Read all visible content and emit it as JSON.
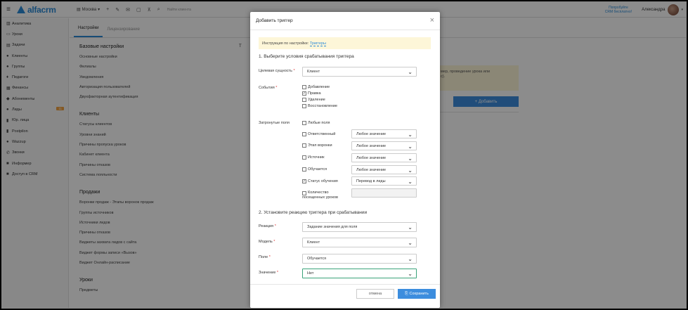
{
  "topbar": {
    "branch": "Москва",
    "search_placeholder": "Найти клиента",
    "try_crm_line1": "Попробуйте",
    "try_crm_line2": "CRM бесплатно!",
    "user_name": "Александра"
  },
  "sidebar": {
    "items": [
      {
        "label": "Аналитика",
        "icon": "chart-icon"
      },
      {
        "label": "Уроки",
        "icon": "calendar-icon"
      },
      {
        "label": "Задачи",
        "icon": "tasks-icon"
      },
      {
        "label": "Клиенты",
        "icon": "user-icon"
      },
      {
        "label": "Группы",
        "icon": "group-icon"
      },
      {
        "label": "Педагоги",
        "icon": "teacher-icon"
      },
      {
        "label": "Финансы",
        "icon": "finance-icon"
      },
      {
        "label": "Абонементы",
        "icon": "ticket-icon"
      },
      {
        "label": "Лиды",
        "icon": "leads-icon",
        "badge": "11"
      },
      {
        "label": "Юр. лица",
        "icon": "company-icon"
      },
      {
        "label": "Postpilon",
        "icon": "postpilon-icon"
      },
      {
        "label": "Wazzup",
        "icon": "wazzup-icon"
      },
      {
        "label": "Звонки",
        "icon": "phone-icon"
      },
      {
        "label": "Информер",
        "icon": "informer-icon"
      },
      {
        "label": "Доступ в CRM",
        "icon": "lock-icon"
      }
    ]
  },
  "tabs": [
    "Настройки",
    "Лицензирование"
  ],
  "settings": {
    "sections": [
      {
        "title": "Базовые настройки",
        "links": [
          "Основные настройки",
          "Филиалы",
          "Уведомления",
          "Авторизация пользователей",
          "Двухфакторная аутентификация"
        ]
      },
      {
        "title": "Клиенты",
        "links": [
          "Статусы клиентов",
          "Уровни знаний",
          "Причины пропуска уроков",
          "Кабинет клиента",
          "Причины отказов",
          "Система лояльности"
        ]
      },
      {
        "title": "Продажи",
        "links": [
          "Воронки продаж - Этапы воронок продаж",
          "Группы источников",
          "Источники лидов",
          "Причины отказов",
          "Виджеты захвата лидов с сайта",
          "Виджет формы записи «Вызов»",
          "Виджет Онлайн-расписание"
        ]
      },
      {
        "title": "Уроки",
        "links": [
          "Предметы"
        ]
      }
    ]
  },
  "background": {
    "t_letter": "Т",
    "info_text_line1": "мер, проведение урока или",
    "info_text_line2": "с).",
    "add_button": "+ Добавить"
  },
  "modal": {
    "title": "Добавить триггер",
    "hint_text": "Инструкция по настройке:",
    "hint_link": "Триггеры",
    "step1": "1. Выберите условия срабатывания триггера",
    "target_label": "Целевая сущность",
    "target_value": "Клиент",
    "events_label": "События",
    "events": [
      {
        "label": "Добавление",
        "checked": false
      },
      {
        "label": "Правка",
        "checked": true
      },
      {
        "label": "Удаление",
        "checked": false
      },
      {
        "label": "Восстановление",
        "checked": false
      }
    ],
    "fields_label": "Затронутые поля",
    "any_fields": "Любые поля",
    "fields": [
      {
        "label": "Ответственный",
        "checked": false,
        "value": "Любое значение"
      },
      {
        "label": "Этап воронки",
        "checked": false,
        "value": "Любое значение"
      },
      {
        "label": "Источник",
        "checked": false,
        "value": "Любое значение"
      },
      {
        "label": "Обучается",
        "checked": false,
        "value": "Любое значение"
      },
      {
        "label": "Статус обучения",
        "checked": true,
        "value": "Перевод в лиды"
      },
      {
        "label_line1": "Количество",
        "label_line2": "посещенных уроков",
        "checked": false,
        "value": ""
      }
    ],
    "step2": "2. Установите реакцию триггера при срабатывании",
    "reaction_label": "Реакция",
    "reaction_value": "Задание значения для поля",
    "model_label": "Модель",
    "model_value": "Клиент",
    "field_label": "Поле",
    "field_value": "Обучается",
    "value_label": "Значение",
    "value_value": "Нет",
    "cancel": "отмена",
    "save": "Сохранить",
    "required_mark": "*"
  },
  "colors": {
    "accent": "#3c8dde",
    "brand": "#2b8bd8",
    "hint_bg": "#fdf6d8",
    "badge": "#f0a040"
  }
}
